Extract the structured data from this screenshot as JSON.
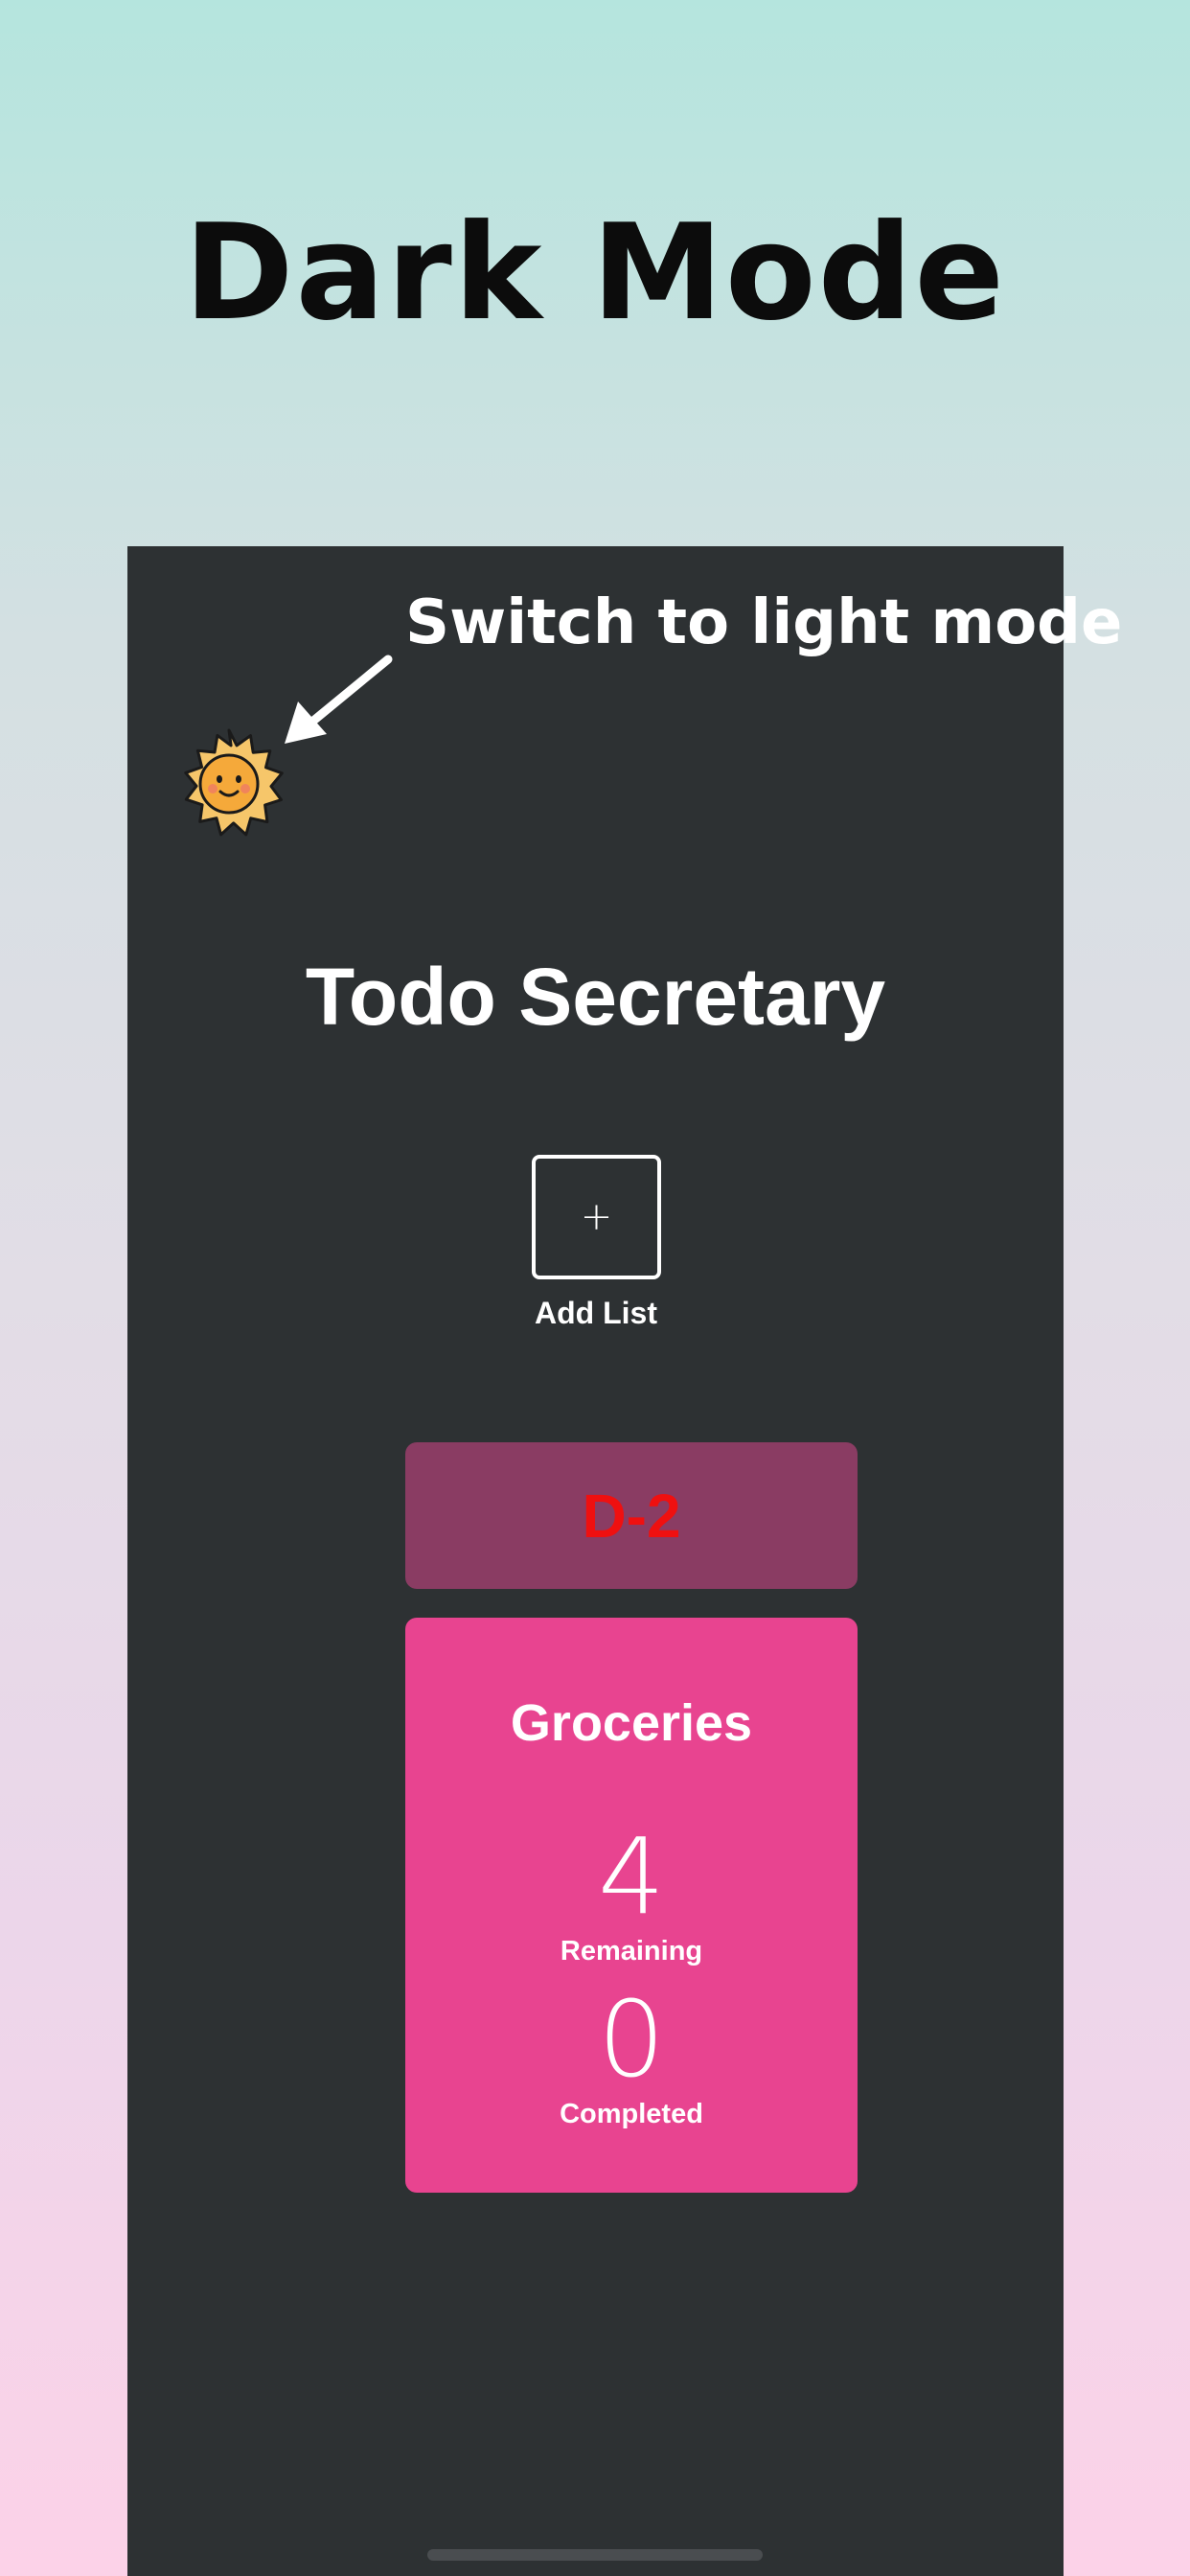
{
  "headline": "Dark Mode",
  "annotation": "Switch to light mode",
  "app": {
    "title": "Todo Secretary",
    "add_list_icon": "+",
    "add_list_label": "Add List",
    "theme_toggle_icon": "sun-icon"
  },
  "dday_badge": "D-2",
  "list_card": {
    "title": "Groceries",
    "remaining_count": "4",
    "remaining_label": "Remaining",
    "completed_count": "0",
    "completed_label": "Completed"
  },
  "colors": {
    "background_top": "#b5e5de",
    "background_bottom": "#fcd2e8",
    "app_background": "#2d3133",
    "dday_background": "#8a3c63",
    "dday_text": "#ef1010",
    "card_background": "#e84490",
    "sun": "#f6b648"
  }
}
